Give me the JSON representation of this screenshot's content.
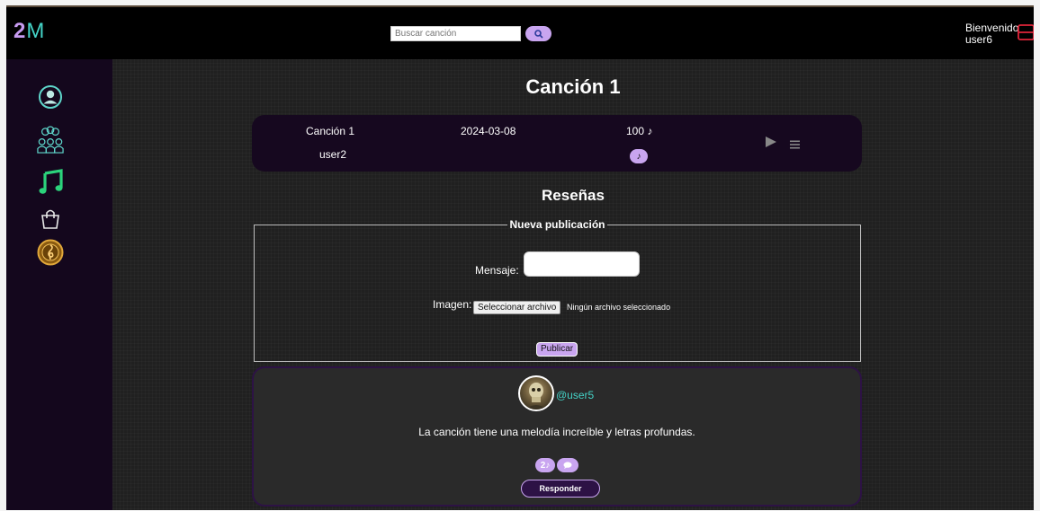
{
  "header": {
    "logo_number": "2",
    "logo_letter": "M",
    "search_placeholder": "Buscar canción",
    "welcome_label": "Bienvenido",
    "username": "user6"
  },
  "sidebar": {
    "items": [
      {
        "icon": "user-circle-icon"
      },
      {
        "icon": "group-icon"
      },
      {
        "icon": "music-note-icon",
        "active": true
      },
      {
        "icon": "shopping-bag-icon"
      },
      {
        "icon": "treble-clef-badge-icon"
      }
    ]
  },
  "main": {
    "title": "Canción 1",
    "song": {
      "name": "Canción 1",
      "artist": "user2",
      "date": "2024-03-08",
      "likes": "100 ♪",
      "like_badge": "♪"
    },
    "reviews_title": "Reseñas",
    "new_post": {
      "legend": "Nueva publicación",
      "message_label": "Mensaje:",
      "image_label": "Imagen:",
      "file_button": "Seleccionar archivo",
      "file_status": "Ningún archivo seleccionado",
      "publish_button": "Publicar"
    },
    "review": {
      "user": "@user5",
      "text": "La canción tiene una melodía increíble y letras profundas.",
      "likes": "2♪",
      "reply_button": "Responder"
    }
  },
  "colors": {
    "accent_lilac": "#c9a5f0",
    "accent_teal": "#44d3c7",
    "logout_red": "#e0243a"
  }
}
